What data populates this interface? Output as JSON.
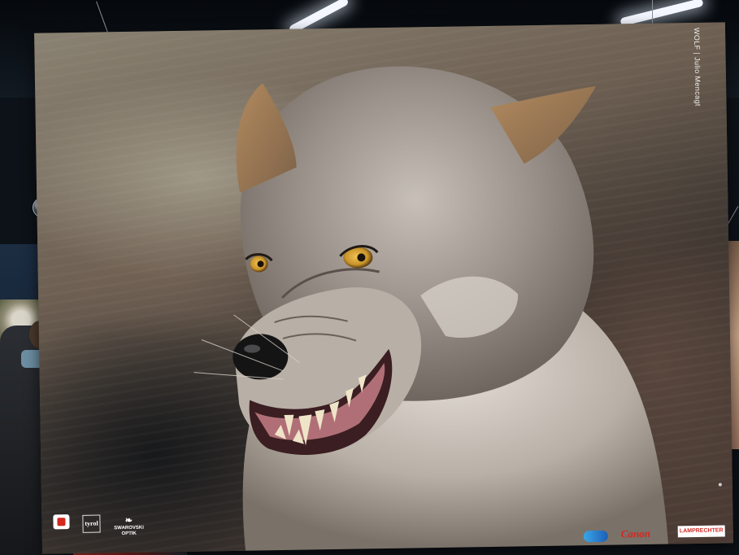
{
  "poster": {
    "caption": "WOLF | Julio Mencagt"
  },
  "sponsors": {
    "tyrol": "tyrol",
    "swarovski": "SWAROVSKI OPTIK",
    "canon": "Canon",
    "lamprechter": "LAMPRECHTER"
  },
  "colors": {
    "wolf_fur": "#9a928a",
    "wolf_eye": "#c9942a",
    "gum": "#b06f76",
    "canon_red": "#d8261d",
    "background_dark": "#0d1218"
  },
  "icons": {
    "left_logo": "red-square-logo-icon",
    "blue_logo": "blue-oval-logo-icon"
  }
}
